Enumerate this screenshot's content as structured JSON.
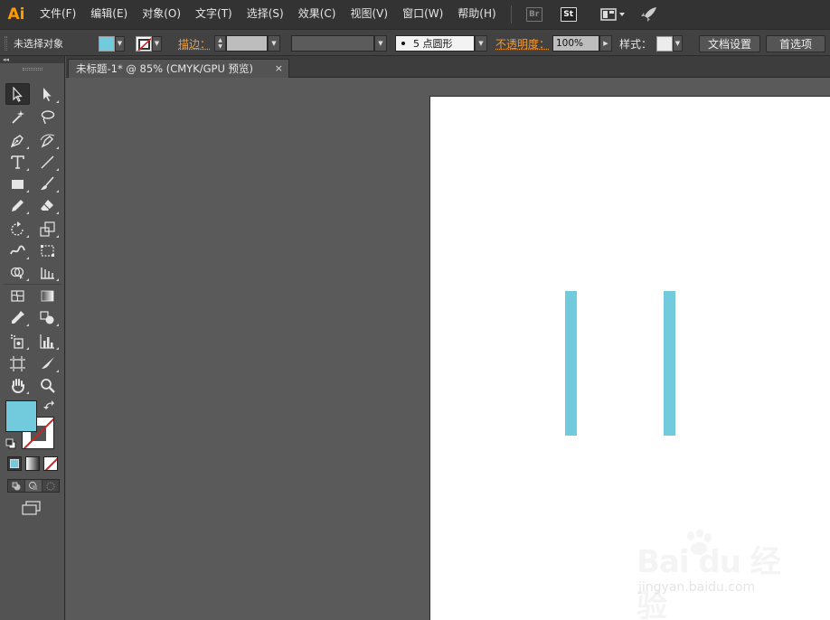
{
  "app": {
    "logo_text": "Ai"
  },
  "menu": {
    "items": [
      {
        "label": "文件(F)"
      },
      {
        "label": "编辑(E)"
      },
      {
        "label": "对象(O)"
      },
      {
        "label": "文字(T)"
      },
      {
        "label": "选择(S)"
      },
      {
        "label": "效果(C)"
      },
      {
        "label": "视图(V)"
      },
      {
        "label": "窗口(W)"
      },
      {
        "label": "帮助(H)"
      }
    ],
    "bridge_badge": "Br",
    "stock_badge": "St",
    "icons": [
      "bridge-icon",
      "stock-icon",
      "workspace-switcher-icon",
      "publish-rocket-icon"
    ]
  },
  "control_bar": {
    "selection_status": "未选择对象",
    "fill_color": "#72cbdc",
    "stroke_color": "none",
    "stroke_label": "描边：",
    "brush_label": "5 点圆形",
    "opacity_label": "不透明度：",
    "opacity_value": "100%",
    "style_label": "样式：",
    "document_setup_button": "文档设置",
    "preferences_button": "首选项"
  },
  "tools": {
    "collapse_arrows": "◂◂",
    "rows": [
      [
        "selection-tool",
        "direct-selection-tool"
      ],
      [
        "magic-wand-tool",
        "lasso-tool"
      ],
      [
        "pen-tool",
        "curvature-tool"
      ],
      [
        "type-tool",
        "line-segment-tool"
      ],
      [
        "rectangle-tool",
        "paintbrush-tool"
      ],
      [
        "pencil-tool",
        "eraser-tool"
      ],
      [
        "rotate-tool",
        "scale-tool"
      ],
      [
        "width-tool",
        "free-transform-tool"
      ],
      [
        "shape-builder-tool",
        "perspective-grid-tool"
      ],
      [
        "mesh-tool",
        "gradient-tool"
      ],
      [
        "eyedropper-tool",
        "blend-tool"
      ],
      [
        "symbol-sprayer-tool",
        "column-graph-tool"
      ],
      [
        "artboard-tool",
        "slice-tool"
      ],
      [
        "hand-tool",
        "zoom-tool"
      ]
    ],
    "fill_color": "#72cbdc"
  },
  "document": {
    "tab_title": "未标题-1* @ 85% (CMYK/GPU 预览)",
    "close_glyph": "×"
  },
  "artwork": {
    "shape_color": "#72cbdc",
    "shape_count": 2
  },
  "watermark": {
    "main": "Bai du 经验",
    "sub": "jingyan.baidu.com"
  }
}
